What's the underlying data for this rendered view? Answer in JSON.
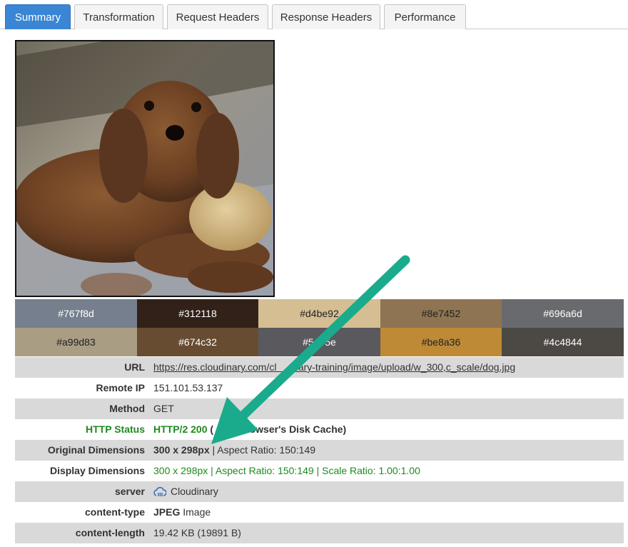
{
  "tabs": [
    {
      "label": "Summary"
    },
    {
      "label": "Transformation"
    },
    {
      "label": "Request Headers"
    },
    {
      "label": "Response Headers"
    },
    {
      "label": "Performance"
    }
  ],
  "palette": [
    {
      "hex": "#767f8d",
      "label": "#767f8d",
      "text_color": "#ffffff"
    },
    {
      "hex": "#312118",
      "label": "#312118",
      "text_color": "#ffffff"
    },
    {
      "hex": "#d4be92",
      "label": "#d4be92",
      "text_color": "#222222"
    },
    {
      "hex": "#8e7452",
      "label": "#8e7452",
      "text_color": "#222222"
    },
    {
      "hex": "#696a6d",
      "label": "#696a6d",
      "text_color": "#ffffff"
    },
    {
      "hex": "#a99d83",
      "label": "#a99d83",
      "text_color": "#222222"
    },
    {
      "hex": "#674c32",
      "label": "#674c32",
      "text_color": "#ffffff"
    },
    {
      "hex": "#59595e",
      "label": "#5    5e",
      "text_color": "#ffffff"
    },
    {
      "hex": "#be8a36",
      "label": "#be8a36",
      "text_color": "#222222"
    },
    {
      "hex": "#4c4844",
      "label": "#4c4844",
      "text_color": "#ffffff"
    }
  ],
  "info": {
    "url": {
      "key": "URL",
      "value": "https://res.cloudinary.com/cl     inary-training/image/upload/w_300,c_scale/dog.jpg"
    },
    "remote_ip": {
      "key": "Remote IP",
      "value": "151.101.53.137"
    },
    "method": {
      "key": "Method",
      "value": "GET"
    },
    "http_status": {
      "key": "HTTP Status",
      "value_bold": "HTTP/2 200",
      "value_rest": " (         Browser's Disk Cache)"
    },
    "original_dimensions": {
      "key": "Original Dimensions",
      "value_bold": "300 x 298px",
      "value_rest": " | Aspect Ratio: 150:149"
    },
    "display_dimensions": {
      "key": "Display Dimensions",
      "value": "300 x 298px | Aspect Ratio: 150:149 | Scale Ratio: 1.00:1.00"
    },
    "server": {
      "key": "server",
      "value": "Cloudinary",
      "icon": "cloudinary-cloud-icon"
    },
    "content_type": {
      "key": "content-type",
      "value_bold": "JPEG",
      "value_rest": " Image"
    },
    "content_length": {
      "key": "content-length",
      "value": "19.42 KB (19891 B)"
    }
  },
  "colors": {
    "tab_active": "#3a86d4",
    "row_shade": "#d9d9d9",
    "status_green": "#1e8a1e",
    "link_blue": "#2f6fb8",
    "annotation_arrow": "#1aaa8c"
  }
}
